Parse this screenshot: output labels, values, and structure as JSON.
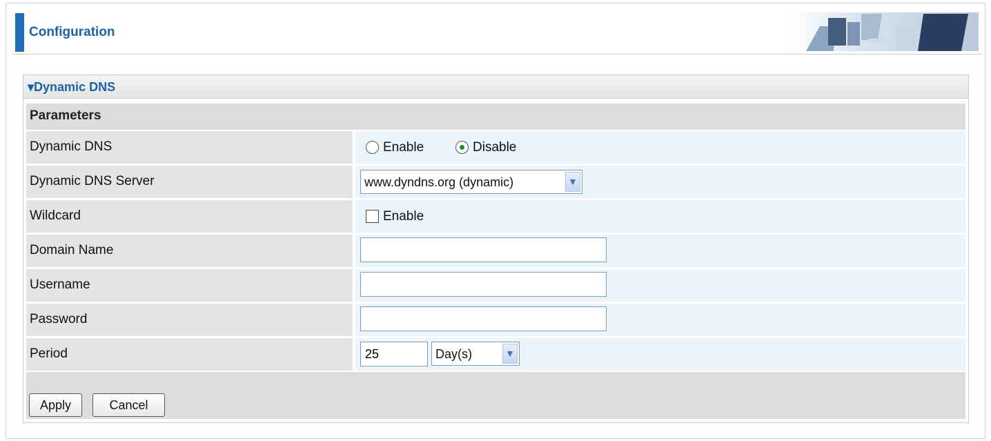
{
  "header": {
    "title": "Configuration"
  },
  "panel": {
    "title": "▾Dynamic DNS",
    "section": "Parameters"
  },
  "rows": {
    "dynamic_dns": {
      "label": "Dynamic DNS",
      "enable_label": "Enable",
      "disable_label": "Disable",
      "selected": "Disable"
    },
    "server": {
      "label": "Dynamic DNS Server",
      "value": "www.dyndns.org (dynamic)"
    },
    "wildcard": {
      "label": "Wildcard",
      "checkbox_label": "Enable",
      "checked": false
    },
    "domain": {
      "label": "Domain Name",
      "value": ""
    },
    "username": {
      "label": "Username",
      "value": ""
    },
    "password": {
      "label": "Password",
      "value": ""
    },
    "period": {
      "label": "Period",
      "value": "25",
      "unit": "Day(s)"
    }
  },
  "buttons": {
    "apply": "Apply",
    "cancel": "Cancel"
  },
  "colors": {
    "accent": "#1d6fb8",
    "title_text": "#1a63a8",
    "label_bg": "#e4e4e4",
    "value_bg": "#ebf3fb"
  }
}
